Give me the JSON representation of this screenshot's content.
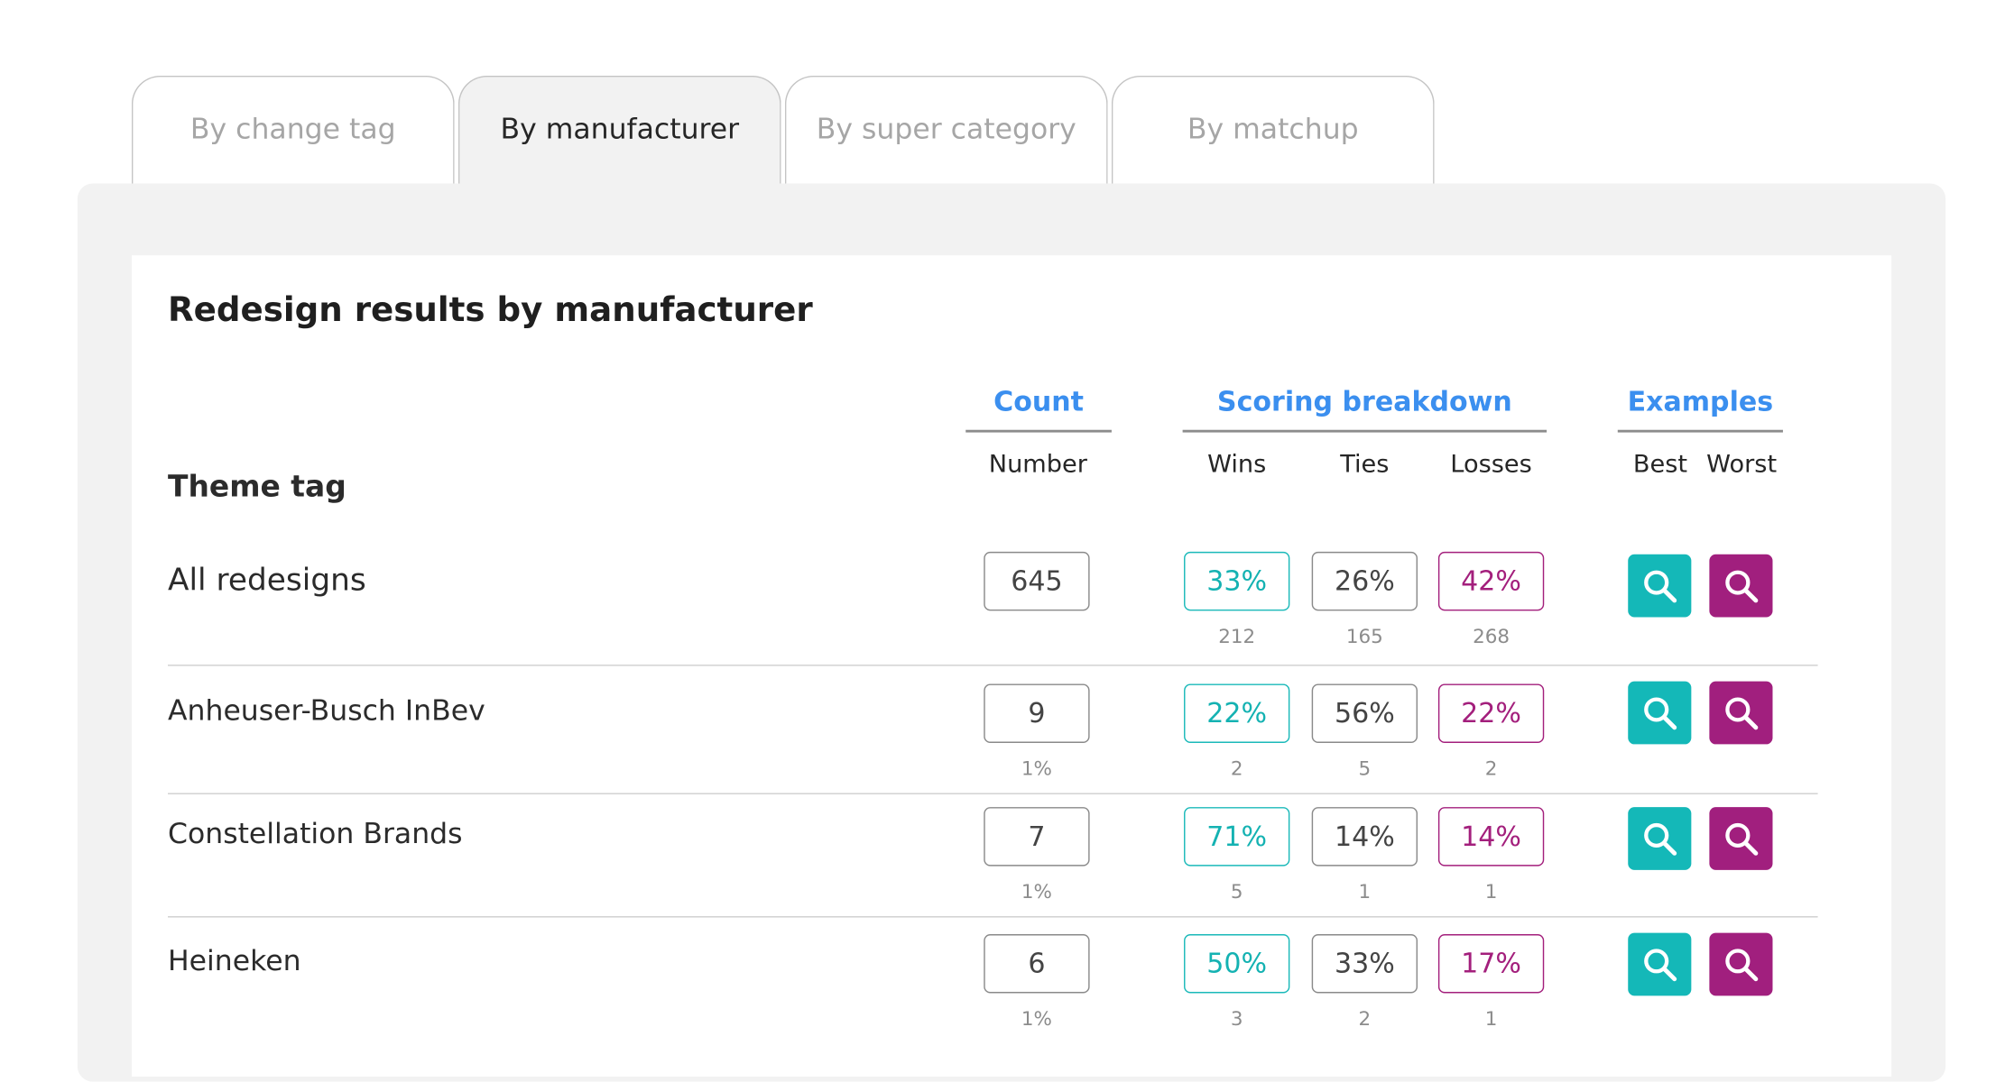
{
  "tabs": [
    {
      "label": "By change tag",
      "active": false
    },
    {
      "label": "By manufacturer",
      "active": true
    },
    {
      "label": "By super category",
      "active": false
    },
    {
      "label": "By matchup",
      "active": false
    }
  ],
  "card": {
    "title": "Redesign results by manufacturer",
    "theme_header": "Theme tag",
    "groups": {
      "count": {
        "label": "Count",
        "columns": [
          "Number"
        ]
      },
      "scoring": {
        "label": "Scoring breakdown",
        "columns": [
          "Wins",
          "Ties",
          "Losses"
        ]
      },
      "examples": {
        "label": "Examples",
        "columns": [
          "Best",
          "Worst"
        ]
      }
    }
  },
  "rows": [
    {
      "label": "All redesigns",
      "count": "645",
      "count_pct": "",
      "wins": "33%",
      "wins_n": "212",
      "ties": "26%",
      "ties_n": "165",
      "losses": "42%",
      "losses_n": "268"
    },
    {
      "label": "Anheuser-Busch InBev",
      "count": "9",
      "count_pct": "1%",
      "wins": "22%",
      "wins_n": "2",
      "ties": "56%",
      "ties_n": "5",
      "losses": "22%",
      "losses_n": "2"
    },
    {
      "label": "Constellation Brands",
      "count": "7",
      "count_pct": "1%",
      "wins": "71%",
      "wins_n": "5",
      "ties": "14%",
      "ties_n": "1",
      "losses": "14%",
      "losses_n": "1"
    },
    {
      "label": "Heineken",
      "count": "6",
      "count_pct": "1%",
      "wins": "50%",
      "wins_n": "3",
      "ties": "33%",
      "ties_n": "2",
      "losses": "17%",
      "losses_n": "1"
    }
  ],
  "icons": {
    "best_button": "search-icon",
    "worst_button": "search-icon"
  },
  "colors": {
    "accent_blue": "#3b8fef",
    "win_teal": "#14b8b8",
    "loss_magenta": "#a11f7e",
    "panel_gray": "#f2f2f2"
  }
}
